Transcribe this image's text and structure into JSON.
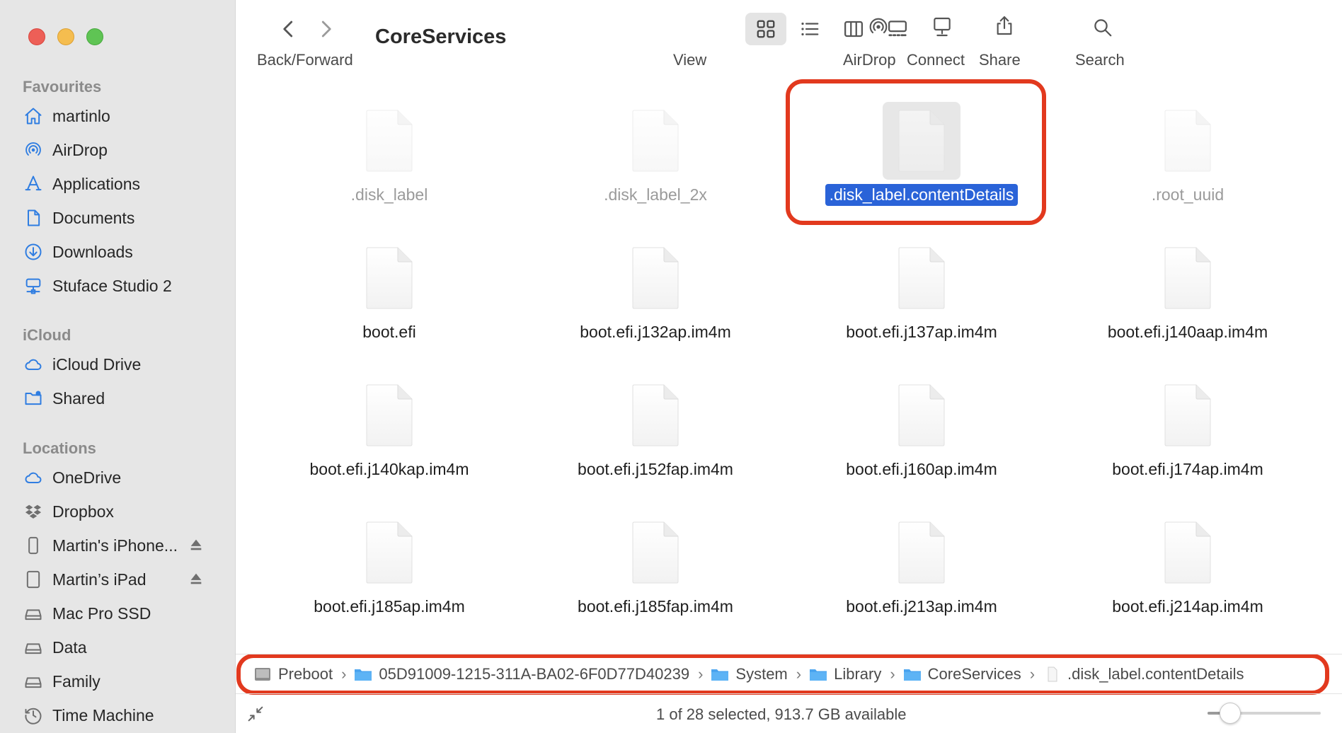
{
  "window": {
    "title": "CoreServices"
  },
  "toolbar": {
    "back_forward_label": "Back/Forward",
    "view_label": "View",
    "airdrop_label": "AirDrop",
    "connect_label": "Connect",
    "share_label": "Share",
    "search_label": "Search"
  },
  "sidebar": {
    "favourites_header": "Favourites",
    "favourites": [
      {
        "label": "martinlo",
        "icon": "home-icon"
      },
      {
        "label": "AirDrop",
        "icon": "airdrop-icon"
      },
      {
        "label": "Applications",
        "icon": "applications-icon"
      },
      {
        "label": "Documents",
        "icon": "document-icon"
      },
      {
        "label": "Downloads",
        "icon": "download-icon"
      },
      {
        "label": "Stuface Studio 2",
        "icon": "network-drive-icon"
      }
    ],
    "icloud_header": "iCloud",
    "icloud": [
      {
        "label": "iCloud Drive",
        "icon": "cloud-icon"
      },
      {
        "label": "Shared",
        "icon": "shared-folder-icon"
      }
    ],
    "locations_header": "Locations",
    "locations": [
      {
        "label": "OneDrive",
        "icon": "cloud-icon"
      },
      {
        "label": "Dropbox",
        "icon": "dropbox-icon"
      },
      {
        "label": "Martin's iPhone...",
        "icon": "iphone-icon"
      },
      {
        "label": "Martin’s iPad",
        "icon": "ipad-icon"
      },
      {
        "label": "Mac Pro SSD",
        "icon": "disk-icon"
      },
      {
        "label": "Data",
        "icon": "disk-icon"
      },
      {
        "label": "Family",
        "icon": "disk-icon"
      },
      {
        "label": "Time Machine",
        "icon": "time-machine-icon"
      }
    ]
  },
  "files": [
    {
      "name": ".disk_label",
      "hidden": true
    },
    {
      "name": ".disk_label_2x",
      "hidden": true
    },
    {
      "name": ".disk_label.contentDetails",
      "hidden": true,
      "selected": true
    },
    {
      "name": ".root_uuid",
      "hidden": true
    },
    {
      "name": "boot.efi"
    },
    {
      "name": "boot.efi.j132ap.im4m"
    },
    {
      "name": "boot.efi.j137ap.im4m"
    },
    {
      "name": "boot.efi.j140aap.im4m"
    },
    {
      "name": "boot.efi.j140kap.im4m"
    },
    {
      "name": "boot.efi.j152fap.im4m"
    },
    {
      "name": "boot.efi.j160ap.im4m"
    },
    {
      "name": "boot.efi.j174ap.im4m"
    },
    {
      "name": "boot.efi.j185ap.im4m"
    },
    {
      "name": "boot.efi.j185fap.im4m"
    },
    {
      "name": "boot.efi.j213ap.im4m"
    },
    {
      "name": "boot.efi.j214ap.im4m"
    }
  ],
  "pathbar": [
    {
      "label": "Preboot",
      "icon": "disk-icon"
    },
    {
      "label": "05D91009-1215-311A-BA02-6F0D77D40239",
      "icon": "folder-icon"
    },
    {
      "label": "System",
      "icon": "folder-icon"
    },
    {
      "label": "Library",
      "icon": "folder-icon"
    },
    {
      "label": "CoreServices",
      "icon": "folder-icon"
    },
    {
      "label": ".disk_label.contentDetails",
      "icon": "file-icon"
    }
  ],
  "status": {
    "text": "1 of 28 selected, 913.7 GB available",
    "icon_size_level": 0.2
  },
  "colors": {
    "accent": "#2a63d8",
    "highlight": "#e2391e",
    "sidebar_icon": "#2f7de1"
  }
}
